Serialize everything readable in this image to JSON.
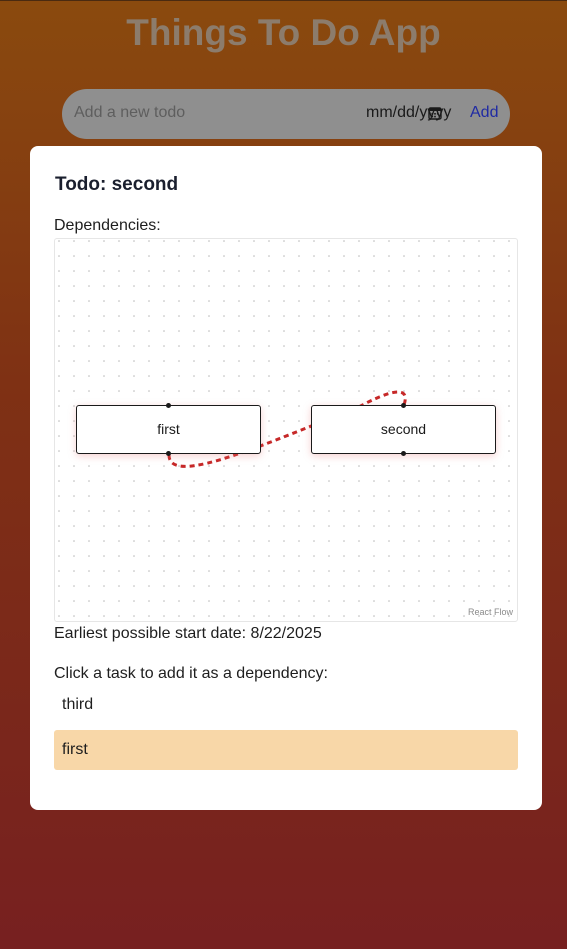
{
  "app": {
    "title": "Things To Do App"
  },
  "form": {
    "new_todo_placeholder": "Add a new todo",
    "date_placeholder": "mm/dd/yyyy",
    "add_label": "Add",
    "calendar_icon": "calendar-icon"
  },
  "modal": {
    "title": "Todo: second",
    "dependencies_label": "Dependencies:",
    "graph": {
      "nodes": [
        {
          "label": "first"
        },
        {
          "label": "second"
        }
      ],
      "edge": {
        "from": "first",
        "to": "second",
        "style": "dashed-animated",
        "color": "#c62828"
      },
      "attribution": "React Flow"
    },
    "start_date_text": "Earliest possible start date: 8/22/2025",
    "click_label": "Click a task to add it as a dependency:",
    "tasks": [
      {
        "label": "third",
        "highlighted": false
      },
      {
        "label": "first",
        "highlighted": true,
        "highlight_color": "#f8d7a8"
      }
    ]
  }
}
